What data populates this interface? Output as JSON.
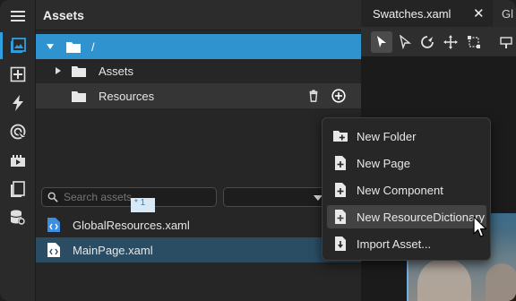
{
  "panel": {
    "title": "Assets",
    "tree": [
      {
        "label": "/"
      },
      {
        "label": "Assets"
      },
      {
        "label": "Resources"
      }
    ],
    "search_placeholder": "Search assets",
    "files": [
      {
        "name": "GlobalResources.xaml"
      },
      {
        "name": "MainPage.xaml"
      }
    ]
  },
  "editor": {
    "tabs": [
      {
        "label": "Swatches.xaml",
        "close": "✕"
      },
      {
        "label": "Gl"
      }
    ],
    "ruler_badge": "* 1"
  },
  "context_menu": {
    "items": [
      {
        "label": "New Folder",
        "icon": "new-folder-icon"
      },
      {
        "label": "New Page",
        "icon": "new-file-icon"
      },
      {
        "label": "New Component",
        "icon": "new-file-icon"
      },
      {
        "label": "New ResourceDictionary",
        "icon": "new-file-icon"
      },
      {
        "label": "Import Asset...",
        "icon": "import-file-icon"
      }
    ],
    "hovered_index": 3
  },
  "colors": {
    "accent": "#2f93cf",
    "selected_file_bg": "#2b4d63",
    "menu_bg": "#272727"
  }
}
